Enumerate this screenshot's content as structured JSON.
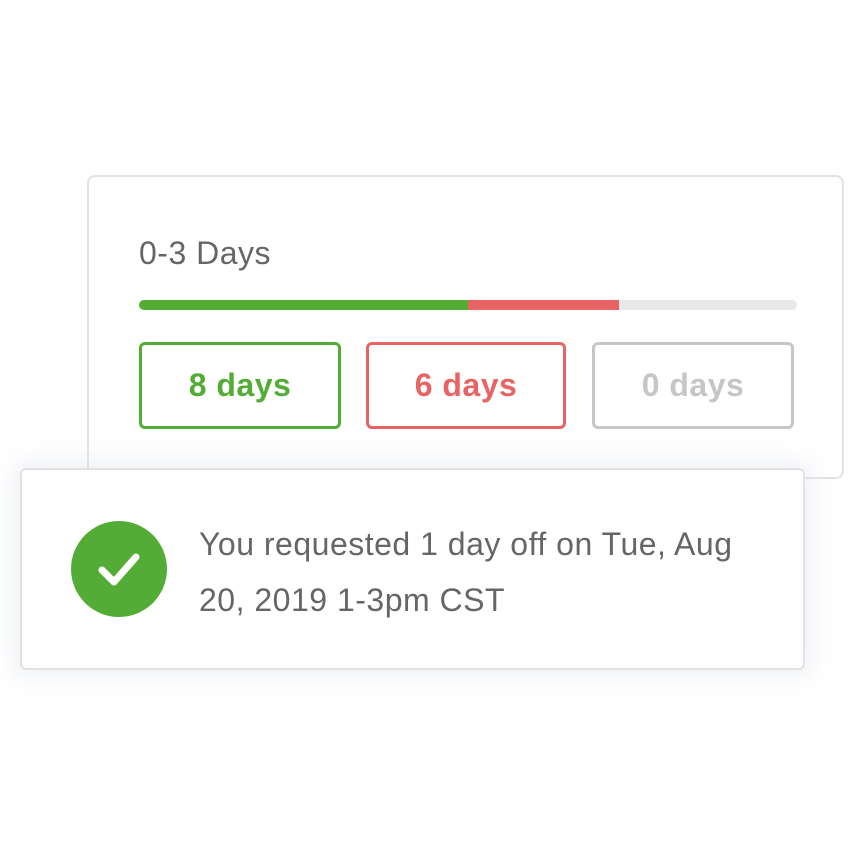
{
  "colors": {
    "accent_green": "#53ac35",
    "accent_red": "#e86363",
    "neutral_gray": "#c6c6c6",
    "track_gray": "#e8e8e8",
    "text_gray": "#666666"
  },
  "balance_card": {
    "range_label": "0-3 Days",
    "progress": {
      "used_fraction": 0.5,
      "pending_fraction": 0.23,
      "remaining_fraction": 0.27
    },
    "pills": {
      "used": "8 days",
      "pending": "6 days",
      "remaining": "0 days"
    }
  },
  "toast": {
    "icon": "checkmark-circle-icon",
    "message": "You requested 1 day off on Tue, Aug 20, 2019 1-3pm CST"
  }
}
